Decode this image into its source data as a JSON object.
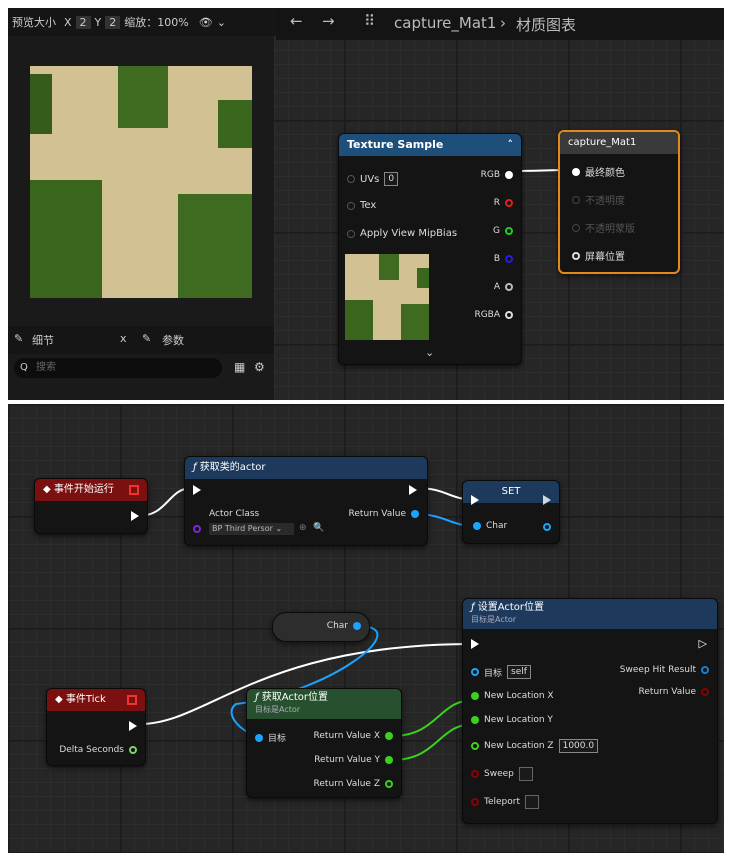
{
  "preview": {
    "size_label": "预览大小",
    "x_label": "X",
    "x_value": "2",
    "y_label": "Y",
    "y_value": "2",
    "zoom_label": "缩放：100%"
  },
  "details": {
    "tab_details": "细节",
    "tab_params": "参数",
    "close": "x",
    "search_placeholder": "搜索"
  },
  "editor": {
    "breadcrumb_item": "capture_Mat1",
    "breadcrumb_sep": "›",
    "breadcrumb_current": "材质图表"
  },
  "texture_node": {
    "title": "Texture Sample",
    "inputs": [
      "UVs",
      "Tex",
      "Apply View MipBias"
    ],
    "uv_value": "0",
    "outputs": [
      "RGB",
      "R",
      "G",
      "B",
      "A",
      "RGBA"
    ]
  },
  "material_node": {
    "title": "capture_Mat1",
    "pins": [
      "最终颜色",
      "不透明度",
      "不透明蒙版",
      "屏幕位置"
    ]
  },
  "bp": {
    "begin_play": "事件开始运行",
    "get_actor_of_class": "获取类的actor",
    "actor_class_label": "Actor Class",
    "actor_class_value": "BP Third Persor",
    "return_value": "Return Value",
    "set_title": "SET",
    "char": "Char",
    "set_actor_location": "设置Actor位置",
    "target_is_actor": "目标是Actor",
    "target": "目标",
    "self": "self",
    "new_location_x": "New Location X",
    "new_location_y": "New Location Y",
    "new_location_z": "New Location Z",
    "z_value": "1000.0",
    "sweep": "Sweep",
    "teleport": "Teleport",
    "sweep_hit_result": "Sweep Hit Result",
    "tick": "事件Tick",
    "delta_seconds": "Delta Seconds",
    "get_actor_location": "获取Actor位置",
    "return_x": "Return Value X",
    "return_y": "Return Value Y",
    "return_z": "Return Value Z"
  },
  "colors": {
    "exec": "#ffffff",
    "object_pin": "#1aa3ff",
    "float_pin": "#7cd36b",
    "vector_pin": "#3ad21f",
    "bool_pin": "#8b0000",
    "event_header": "#7a1010",
    "function_header": "#1d3a5c",
    "pure_header": "#27512e",
    "material_border": "#e08a1e"
  }
}
